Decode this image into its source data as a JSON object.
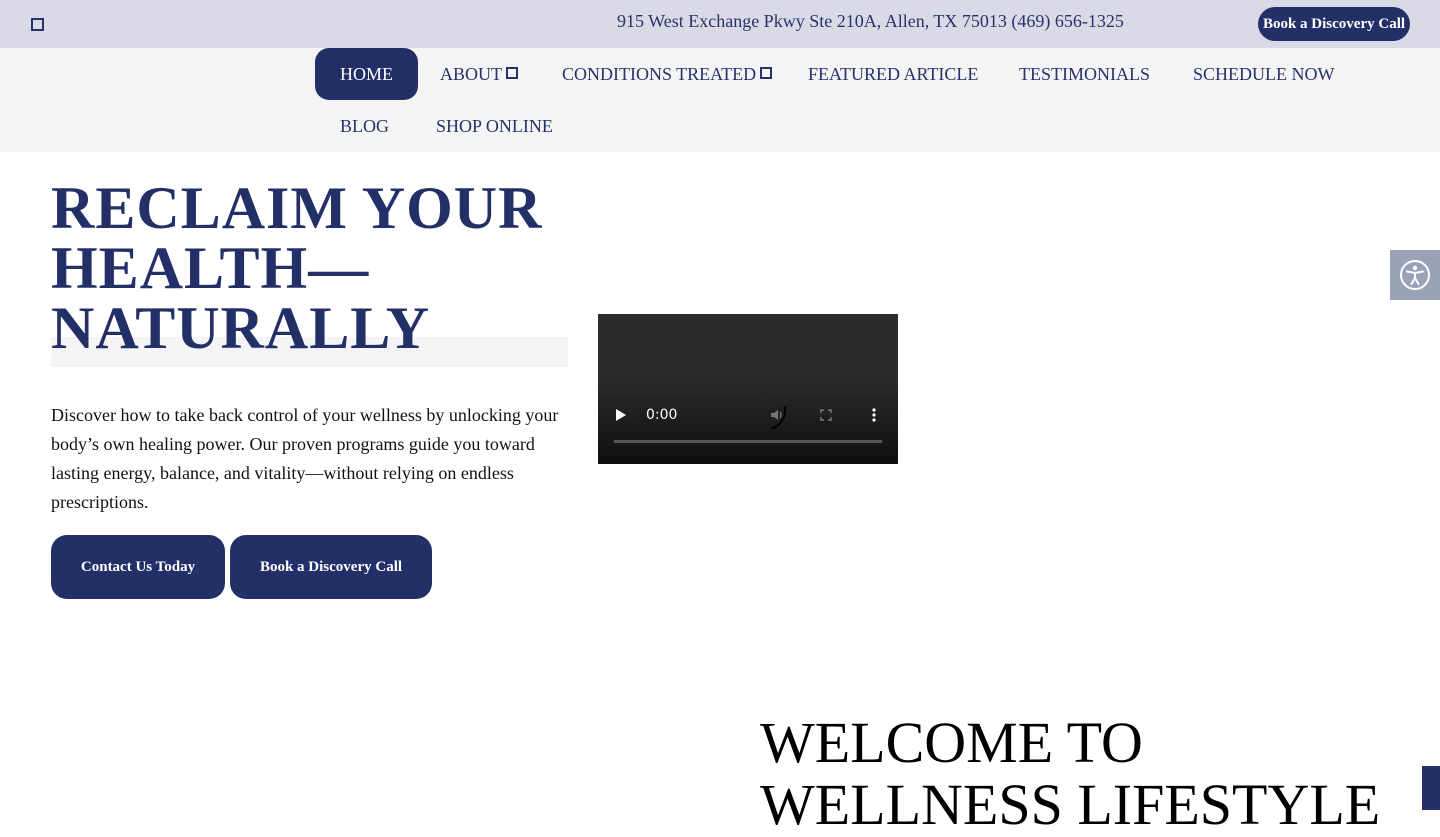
{
  "topbar": {
    "address": "915 West Exchange Pkwy Ste 210A, Allen, TX 75013 (469) 656-1325",
    "cta_label": "Book a Discovery Call"
  },
  "nav": {
    "items": [
      {
        "label": "HOME",
        "active": true
      },
      {
        "label": "ABOUT",
        "has_dropdown": true
      },
      {
        "label": "CONDITIONS TREATED",
        "has_dropdown": true
      },
      {
        "label": "FEATURED ARTICLE"
      },
      {
        "label": "TESTIMONIALS"
      },
      {
        "label": "SCHEDULE NOW"
      },
      {
        "label": "BLOG"
      },
      {
        "label": "SHOP ONLINE"
      }
    ]
  },
  "hero": {
    "title_line1": "RECLAIM YOUR",
    "title_line2": "HEALTH—",
    "title_line3": "NATURALLY",
    "description": "Discover how to take back control of your wellness by unlocking your body’s own healing power. Our proven programs guide you toward lasting energy, balance, and vitality—without relying on endless prescriptions.",
    "contact_button": "Contact Us Today",
    "book_button": "Book a Discovery Call"
  },
  "video": {
    "time": "0:00",
    "icons": [
      "play-icon",
      "mute-icon",
      "fullscreen-icon",
      "more-options-icon"
    ]
  },
  "welcome": {
    "line1": "WELCOME TO",
    "line2": "WELLNESS LIFESTYLE"
  },
  "colors": {
    "brand_navy": "#233068",
    "topbar_bg": "#d9dae6",
    "nav_bg": "#f4f4f5",
    "accessibility_bg": "#9aa2b8"
  }
}
